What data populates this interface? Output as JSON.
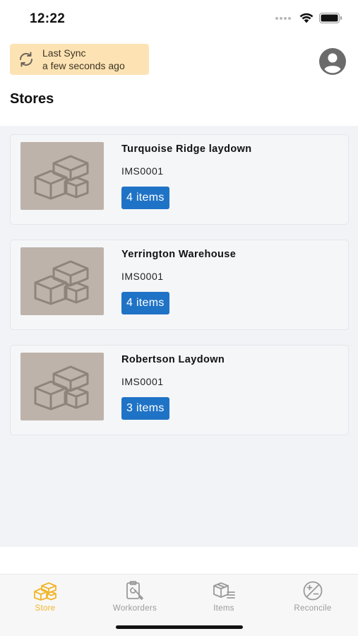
{
  "status_bar": {
    "time": "12:22"
  },
  "sync": {
    "title": "Last Sync",
    "subtitle": "a few seconds ago"
  },
  "page": {
    "title": "Stores"
  },
  "stores": [
    {
      "name": "Turquoise Ridge laydown",
      "code": "IMS0001",
      "items": "4 items"
    },
    {
      "name": "Yerrington Warehouse",
      "code": "IMS0001",
      "items": "4 items"
    },
    {
      "name": "Robertson Laydown",
      "code": "IMS0001",
      "items": "3 items"
    }
  ],
  "tabs": [
    {
      "label": "Store",
      "icon": "boxes-icon",
      "active": true
    },
    {
      "label": "Workorders",
      "icon": "clipboard-wrench-icon",
      "active": false
    },
    {
      "label": "Items",
      "icon": "box-list-icon",
      "active": false
    },
    {
      "label": "Reconcile",
      "icon": "plus-minus-icon",
      "active": false
    }
  ],
  "colors": {
    "accent": "#f2b52a",
    "badge": "#1f73c6",
    "sync_bg": "#fde3b4",
    "thumb_bg": "#bdb3aa"
  }
}
